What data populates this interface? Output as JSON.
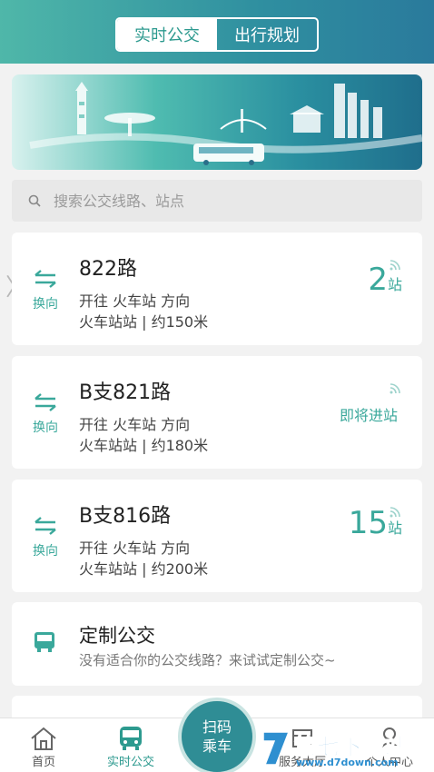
{
  "header": {
    "tabs": [
      "实时公交",
      "出行规划"
    ],
    "active_tab": 0
  },
  "search": {
    "placeholder": "搜索公交线路、站点"
  },
  "routes": [
    {
      "name": "822路",
      "swap_label": "换向",
      "direction": "开往 火车站 方向",
      "stop": "火车站站 | 约150米",
      "eta_number": "2",
      "eta_unit": "站",
      "eta_text": ""
    },
    {
      "name": "B支821路",
      "swap_label": "换向",
      "direction": "开往 火车站 方向",
      "stop": "火车站站 | 约180米",
      "eta_number": "",
      "eta_unit": "",
      "eta_text": "即将进站"
    },
    {
      "name": "B支816路",
      "swap_label": "换向",
      "direction": "开往 火车站 方向",
      "stop": "火车站站 | 约200米",
      "eta_number": "15",
      "eta_unit": "站",
      "eta_text": ""
    }
  ],
  "custom_bus": {
    "title": "定制公交",
    "description": "没有适合你的公交线路？来试试定制公交~"
  },
  "tabbar": {
    "items": [
      {
        "label": "首页",
        "icon": "home-icon"
      },
      {
        "label": "实时公交",
        "icon": "bus-icon"
      },
      {
        "label": "服务大厅",
        "icon": "service-icon"
      },
      {
        "label": "个人中心",
        "icon": "user-icon"
      }
    ],
    "scan": {
      "line1": "扫码",
      "line2": "乘车"
    }
  },
  "watermark": {
    "title": "第七下载站",
    "url": "www.d7down.com"
  },
  "colors": {
    "accent": "#3aa89b",
    "header_start": "#4fb7a9",
    "header_end": "#2a7a9c"
  }
}
